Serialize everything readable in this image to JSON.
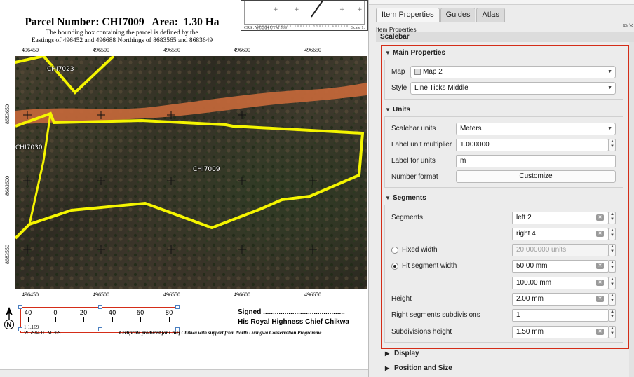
{
  "canvas": {
    "title": "Parcel Number: CHI7009   Area:  1.30 Ha",
    "subtitle_line1": "The bounding box containing the parcel is defined by the",
    "subtitle_line2": "Eastings of 496452 and 496688 Northings of 8683565 and 8683649",
    "eastings_top": [
      "496450",
      "496500",
      "496550",
      "496600",
      "496650"
    ],
    "eastings_bottom": [
      "496450",
      "496500",
      "496550",
      "496600",
      "496650"
    ],
    "northings": [
      "8683650",
      "8683600",
      "8683550"
    ],
    "parcel_labels": [
      "CHI7023",
      "CHI7030",
      "CHI7009"
    ],
    "overview_crs": "CRS : WGS84 UTM 36S",
    "overview_scale": "Scale 1:",
    "overview_ticks": "400000 450000 500000 550000 600000 650000",
    "scalebar_labels": [
      "40",
      "0",
      "20",
      "40",
      "60",
      "80"
    ],
    "scale_text": "1:1,169",
    "crs_text": "WGS84 UTM 36S",
    "north_label": "N",
    "signed_text": "Signed ..........................................",
    "chief_text": "His Royal Highness Chief Chikwa",
    "certificate_text": "Certificate produced for Chief Chikwa with support from North Luangwa Conservation Programme"
  },
  "dock": {
    "tabs": [
      "Item Properties",
      "Guides",
      "Atlas"
    ],
    "active_tab": "Item Properties",
    "panel_title": "Item Properties",
    "item_type": "Scalebar",
    "main_properties": {
      "header": "Main Properties",
      "map_label": "Map",
      "map_value": "Map 2",
      "style_label": "Style",
      "style_value": "Line Ticks Middle"
    },
    "units": {
      "header": "Units",
      "scalebar_units_label": "Scalebar units",
      "scalebar_units_value": "Meters",
      "multiplier_label": "Label unit multiplier",
      "multiplier_value": "1.000000",
      "label_for_units_label": "Label for units",
      "label_for_units_value": "m",
      "number_format_label": "Number format",
      "customize_button": "Customize"
    },
    "segments": {
      "header": "Segments",
      "segments_label": "Segments",
      "left_value": "left 2",
      "right_value": "right 4",
      "fixed_width_label": "Fixed width",
      "fixed_width_value": "20.000000 units",
      "fit_width_label": "Fit segment width",
      "fit_min_value": "50.00 mm",
      "fit_max_value": "100.00 mm",
      "height_label": "Height",
      "height_value": "2.00 mm",
      "right_subdiv_label": "Right segments subdivisions",
      "right_subdiv_value": "1",
      "subdiv_height_label": "Subdivisions height",
      "subdiv_height_value": "1.50 mm"
    },
    "display_header": "Display",
    "position_header": "Position and Size"
  },
  "colors": {
    "highlight_border": "#d42d18",
    "parcel_outline": "#f5f500",
    "road": "#c4683a"
  }
}
